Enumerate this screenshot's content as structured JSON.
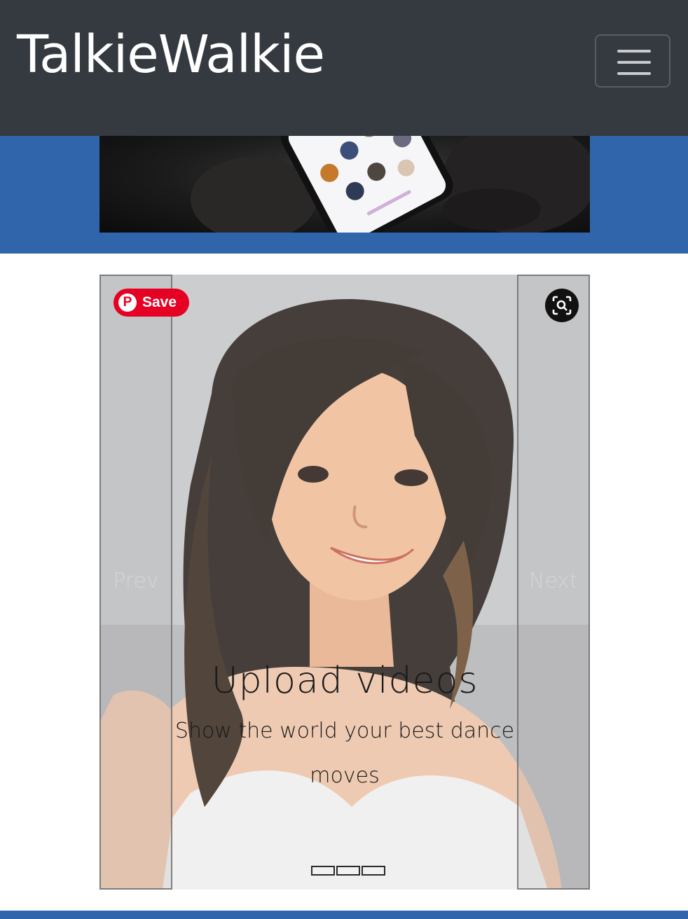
{
  "navbar": {
    "brand": "TalkieWalkie",
    "toggler_icon": "hamburger-menu-icon"
  },
  "hero": {
    "image": "phone-contacts-photo"
  },
  "carousel": {
    "prev_label": "Prev",
    "next_label": "Next",
    "slide_image": "illustrated-portrait",
    "caption_title": "Upload videos",
    "caption_text": "Show the world your best dance moves",
    "indicator_count": 3,
    "active_indicator": 1
  },
  "overlay": {
    "save_label": "Save",
    "save_icon": "pinterest-icon",
    "lens_icon": "visual-search-icon"
  },
  "colors": {
    "navbar_bg": "#343a40",
    "accent_blue": "#3165ab",
    "pinterest_red": "#e60023"
  }
}
